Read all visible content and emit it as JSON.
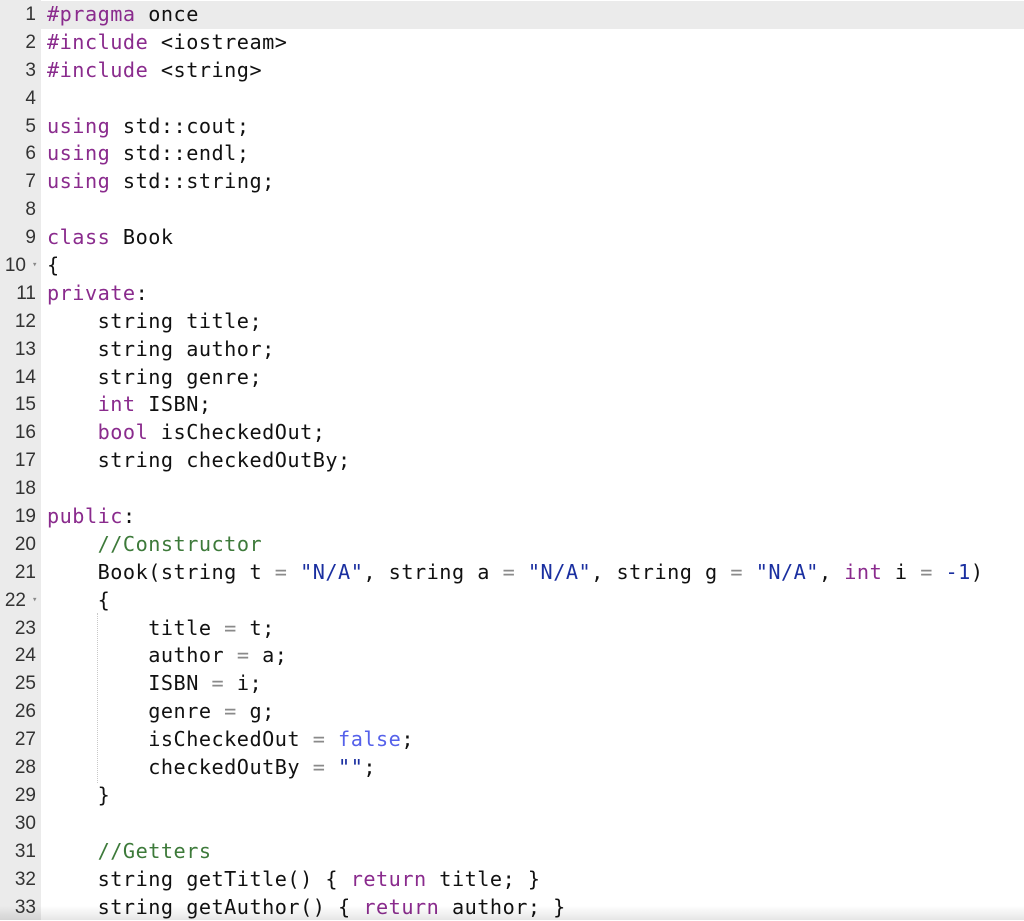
{
  "editor": {
    "active_line": 1,
    "fold_markers": [
      10,
      22
    ],
    "lines": [
      {
        "n": "1",
        "tokens": [
          [
            "pp",
            "#pragma"
          ],
          [
            "pl",
            " once"
          ]
        ]
      },
      {
        "n": "2",
        "tokens": [
          [
            "pp",
            "#include"
          ],
          [
            "pl",
            " <iostream>"
          ]
        ]
      },
      {
        "n": "3",
        "tokens": [
          [
            "pp",
            "#include"
          ],
          [
            "pl",
            " <string>"
          ]
        ]
      },
      {
        "n": "4",
        "tokens": []
      },
      {
        "n": "5",
        "tokens": [
          [
            "kw",
            "using"
          ],
          [
            "pl",
            " std::cout;"
          ]
        ]
      },
      {
        "n": "6",
        "tokens": [
          [
            "kw",
            "using"
          ],
          [
            "pl",
            " std::endl;"
          ]
        ]
      },
      {
        "n": "7",
        "tokens": [
          [
            "kw",
            "using"
          ],
          [
            "pl",
            " std::string;"
          ]
        ]
      },
      {
        "n": "8",
        "tokens": []
      },
      {
        "n": "9",
        "tokens": [
          [
            "kw",
            "class"
          ],
          [
            "pl",
            " Book"
          ]
        ]
      },
      {
        "n": "10",
        "tokens": [
          [
            "pl",
            "{"
          ]
        ]
      },
      {
        "n": "11",
        "tokens": [
          [
            "kw",
            "private"
          ],
          [
            "pl",
            ":"
          ]
        ]
      },
      {
        "n": "12",
        "tokens": [
          [
            "pl",
            "    string title;"
          ]
        ]
      },
      {
        "n": "13",
        "tokens": [
          [
            "pl",
            "    string author;"
          ]
        ]
      },
      {
        "n": "14",
        "tokens": [
          [
            "pl",
            "    string genre;"
          ]
        ]
      },
      {
        "n": "15",
        "tokens": [
          [
            "pl",
            "    "
          ],
          [
            "kw",
            "int"
          ],
          [
            "pl",
            " ISBN;"
          ]
        ]
      },
      {
        "n": "16",
        "tokens": [
          [
            "pl",
            "    "
          ],
          [
            "kw",
            "bool"
          ],
          [
            "pl",
            " isCheckedOut;"
          ]
        ]
      },
      {
        "n": "17",
        "tokens": [
          [
            "pl",
            "    string checkedOutBy;"
          ]
        ]
      },
      {
        "n": "18",
        "tokens": []
      },
      {
        "n": "19",
        "tokens": [
          [
            "kw",
            "public"
          ],
          [
            "pl",
            ":"
          ]
        ]
      },
      {
        "n": "20",
        "tokens": [
          [
            "pl",
            "    "
          ],
          [
            "cmt",
            "//Constructor"
          ]
        ]
      },
      {
        "n": "21",
        "tokens": [
          [
            "pl",
            "    Book(string t "
          ],
          [
            "op",
            "="
          ],
          [
            "pl",
            " "
          ],
          [
            "str",
            "\"N/A\""
          ],
          [
            "pl",
            ", string a "
          ],
          [
            "op",
            "="
          ],
          [
            "pl",
            " "
          ],
          [
            "str",
            "\"N/A\""
          ],
          [
            "pl",
            ", string g "
          ],
          [
            "op",
            "="
          ],
          [
            "pl",
            " "
          ],
          [
            "str",
            "\"N/A\""
          ],
          [
            "pl",
            ", "
          ],
          [
            "kw",
            "int"
          ],
          [
            "pl",
            " i "
          ],
          [
            "op",
            "="
          ],
          [
            "pl",
            " "
          ],
          [
            "num",
            "-1"
          ],
          [
            "pl",
            ")"
          ]
        ]
      },
      {
        "n": "22",
        "tokens": [
          [
            "pl",
            "    {"
          ]
        ]
      },
      {
        "n": "23",
        "tokens": [
          [
            "pl",
            "        title "
          ],
          [
            "op",
            "="
          ],
          [
            "pl",
            " t;"
          ]
        ]
      },
      {
        "n": "24",
        "tokens": [
          [
            "pl",
            "        author "
          ],
          [
            "op",
            "="
          ],
          [
            "pl",
            " a;"
          ]
        ]
      },
      {
        "n": "25",
        "tokens": [
          [
            "pl",
            "        ISBN "
          ],
          [
            "op",
            "="
          ],
          [
            "pl",
            " i;"
          ]
        ]
      },
      {
        "n": "26",
        "tokens": [
          [
            "pl",
            "        genre "
          ],
          [
            "op",
            "="
          ],
          [
            "pl",
            " g;"
          ]
        ]
      },
      {
        "n": "27",
        "tokens": [
          [
            "pl",
            "        isCheckedOut "
          ],
          [
            "op",
            "="
          ],
          [
            "pl",
            " "
          ],
          [
            "bool",
            "false"
          ],
          [
            "pl",
            ";"
          ]
        ]
      },
      {
        "n": "28",
        "tokens": [
          [
            "pl",
            "        checkedOutBy "
          ],
          [
            "op",
            "="
          ],
          [
            "pl",
            " "
          ],
          [
            "str",
            "\"\""
          ],
          [
            "pl",
            ";"
          ]
        ]
      },
      {
        "n": "29",
        "tokens": [
          [
            "pl",
            "    }"
          ]
        ]
      },
      {
        "n": "30",
        "tokens": []
      },
      {
        "n": "31",
        "tokens": [
          [
            "pl",
            "    "
          ],
          [
            "cmt",
            "//Getters"
          ]
        ]
      },
      {
        "n": "32",
        "tokens": [
          [
            "pl",
            "    string getTitle() { "
          ],
          [
            "kw",
            "return"
          ],
          [
            "pl",
            " title; }"
          ]
        ]
      },
      {
        "n": "33",
        "tokens": [
          [
            "pl",
            "    string getAuthor() { "
          ],
          [
            "kw",
            "return"
          ],
          [
            "pl",
            " author; }"
          ]
        ]
      }
    ]
  }
}
